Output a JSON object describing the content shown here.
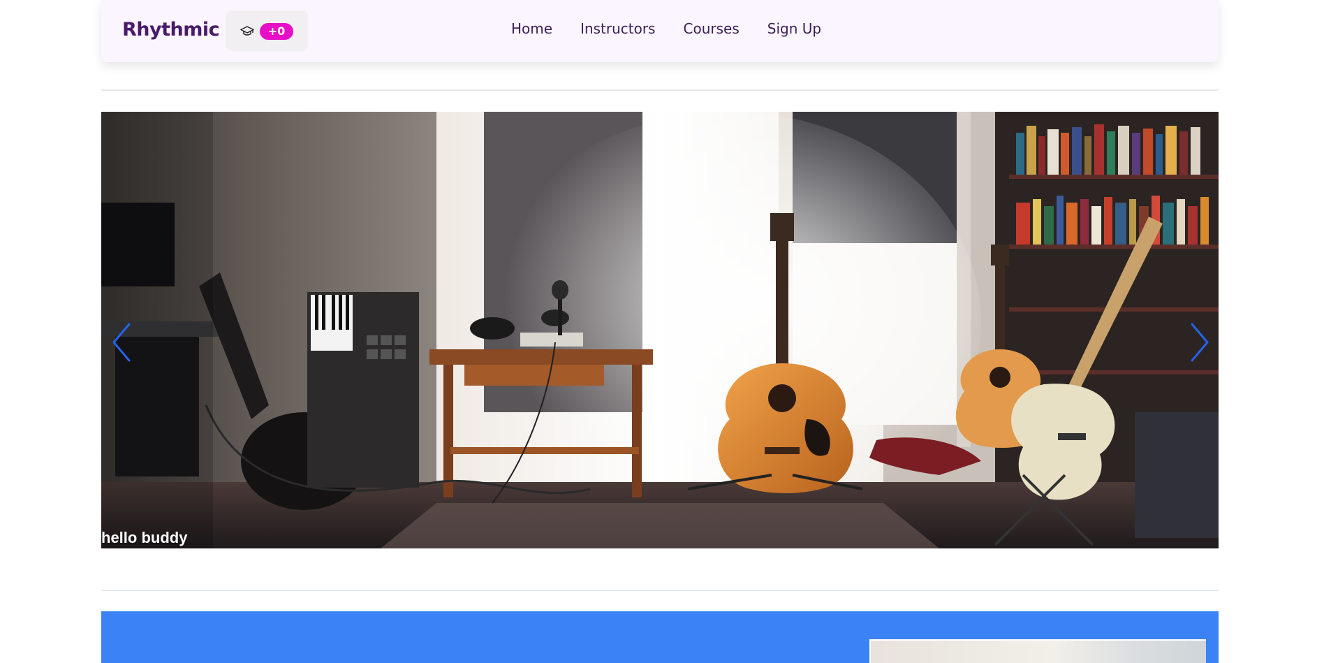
{
  "navbar": {
    "brand": "Rhythmic",
    "cart": {
      "icon": "graduation-cap-icon",
      "badge": "+0"
    },
    "links": [
      {
        "label": "Home"
      },
      {
        "label": "Instructors"
      },
      {
        "label": "Courses"
      },
      {
        "label": "Sign Up"
      }
    ]
  },
  "carousel": {
    "caption": "hello buddy",
    "prev_icon": "chevron-left-icon",
    "next_icon": "chevron-right-icon",
    "image": "music-room-guitars-photo"
  },
  "colors": {
    "navbar_bg": "#faf5ff",
    "brand": "#4a1a6b",
    "badge": "#e60ec7",
    "arrow": "#2563eb",
    "section_bg": "#3b82f6"
  }
}
